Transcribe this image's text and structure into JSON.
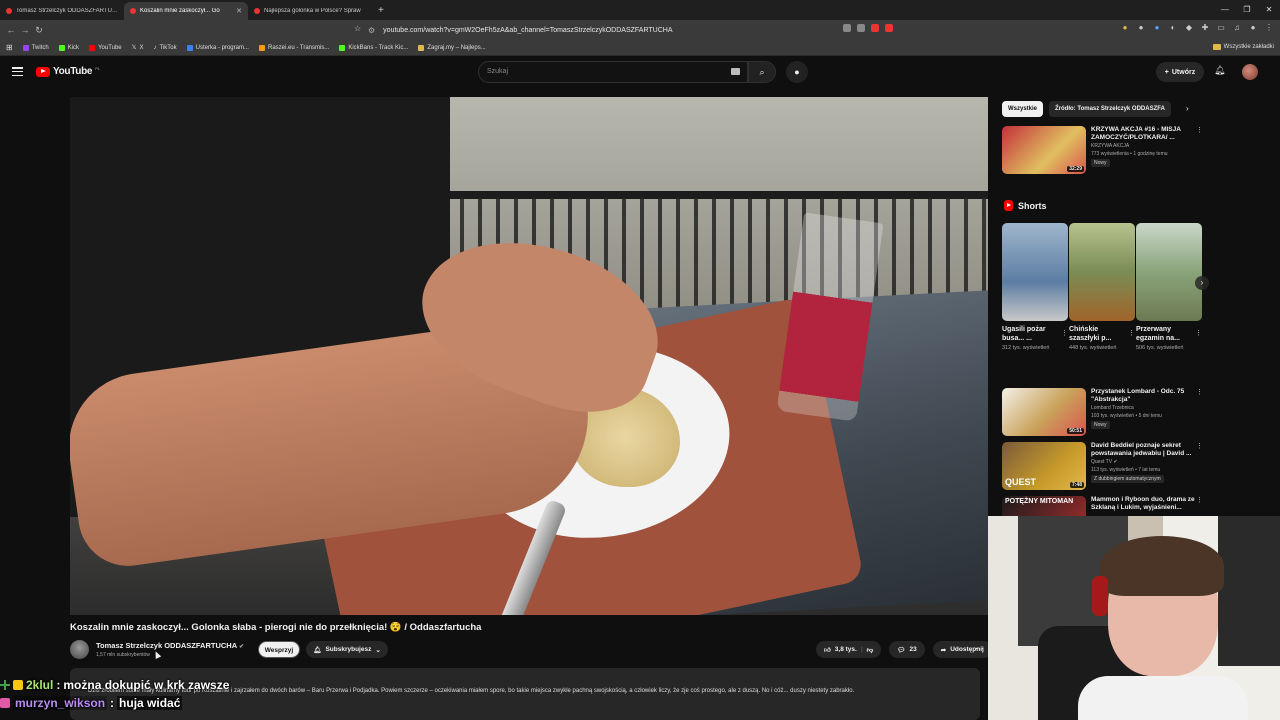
{
  "browser": {
    "tabs": [
      {
        "title": "Tomasz Strzelczyk ODDASZFARTUCHA",
        "active": false
      },
      {
        "title": "Koszalin mnie zaskoczył... Go",
        "active": true
      },
      {
        "title": "Najlepsza golonka w Polsce? Spraw",
        "active": false
      }
    ],
    "url": "youtube.com/watch?v=gmW2OeFh5zA&ab_channel=TomaszStrzelczykODDASZFARTUCHA",
    "bookmarks": [
      {
        "label": "Twitch",
        "color": "#9146ff"
      },
      {
        "label": "Kick",
        "color": "#53fc18"
      },
      {
        "label": "YouTube",
        "color": "#ff0000"
      },
      {
        "label": "X",
        "color": "#ffffff"
      },
      {
        "label": "TikTok",
        "color": "#ffffff"
      },
      {
        "label": "Usterka - program...",
        "color": "#3b82f6"
      },
      {
        "label": "Raszei.eu - Transmis...",
        "color": "#f59e0b"
      },
      {
        "label": "KickBans - Track Kic...",
        "color": "#53fc18"
      },
      {
        "label": "Zagraj.my – Najleps...",
        "color": "#e0b84a"
      }
    ],
    "all_bookmarks": "Wszystkie zakładki"
  },
  "youtube": {
    "logo_text": "YouTube",
    "country": "PL",
    "search_placeholder": "Szukaj",
    "create_label": "Utwórz"
  },
  "video": {
    "title": "Koszalin mnie zaskoczył... Golonka słaba - pierogi nie do przełknięcia! 😵 / Oddaszfartucha",
    "channel": "Tomasz Strzelczyk ODDASZFARTUCHA",
    "verified_mark": "✔",
    "subscribers": "1,57 mln subskrybentów",
    "support_label": "Wesprzyj",
    "subscribed_label": "Subskrybujesz",
    "likes": "3,8 tys.",
    "comments": "23",
    "share_label": "Udostępnij",
    "description": "Dziś zrobiłem sobie mały kulinarny tour po Koszalinie i zajrzałem do dwóch barów – Baru Przerwa i Podjadka. Powiem szczerze – oczekiwania miałem spore, bo takie miejsca zwykle pachną swojskością, a człowiek liczy, że zje coś prostego, ale z duszą. No i cóż... duszy niestety zabrakło."
  },
  "sidebar": {
    "chips": [
      "Wszystkie",
      "Źródło: Tomasz Strzelczyk ODDASZFA"
    ],
    "recommended_top": {
      "title": "KRZYWA AKCJA #16 - MISJA ZAMOCZYĆ/PLOTKARA/ ...",
      "channel": "KRZYWA AKCJA",
      "meta": "773 wyświetlenia • 1 godzinę temu",
      "badge": "Nowy",
      "duration": "32:29"
    },
    "shorts_heading": "Shorts",
    "shorts": [
      {
        "title": "Ugasili pożar busa... ...",
        "views": "312 tys. wyświetleń",
        "color": "#5c7da3"
      },
      {
        "title": "Chińskie szaszłyki p...",
        "views": "448 tys. wyświetleń",
        "color": "#7a8d55"
      },
      {
        "title": "Przerwany egzamin na...",
        "views": "506 tys. wyświetleń",
        "color": "#8aa37a"
      }
    ],
    "recommended": [
      {
        "title": "Przystanek Lombard - Odc. 75 \"Abstrakcja\"",
        "channel": "Lombard Trzebnica",
        "meta": "103 tys. wyświetleń • 5 dni temu",
        "badge": "Nowy",
        "duration": "50:51",
        "color": "#c9a25a"
      },
      {
        "title": "David Beddiel poznaje sekret powstawania jedwabiu | David ...",
        "channel": "Quest TV ✔",
        "meta": "113 tys. wyświetleń • 7 lat temu",
        "badge": "Z dubbingiem automatycznym",
        "duration": "7:48",
        "color": "#c69a2a",
        "thumb_text": "QUEST"
      },
      {
        "title": "Mammon i Ryboon duo, drama ze Szklaną i Lukim, wyjaśnieni...",
        "channel": "",
        "meta": "",
        "badge": "",
        "duration": "",
        "color": "#b22f2f",
        "thumb_text": "POTĘŻNY MITOMAN"
      }
    ]
  },
  "chat": [
    {
      "user": "2klul",
      "message": "można dokupić w krk zawsze"
    },
    {
      "user": "murzyn_wikson",
      "message": "huja widać"
    }
  ]
}
